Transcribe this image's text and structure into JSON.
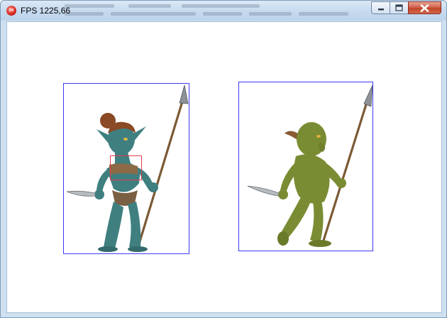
{
  "window": {
    "title": "FPS 1225,66",
    "app_icon_text": "DX",
    "controls": {
      "minimize": "minimize",
      "maximize": "maximize",
      "close": "close"
    }
  },
  "scene": {
    "sprites": [
      {
        "name": "female-goblin-spearwoman",
        "skin_color": "#3f7f80",
        "selected": true
      },
      {
        "name": "male-goblin-spearman",
        "skin_color": "#7a8c33",
        "selected": false
      }
    ],
    "bounding_box_color": "#3b3bf5",
    "hitbox_color": "#e53d4d"
  }
}
